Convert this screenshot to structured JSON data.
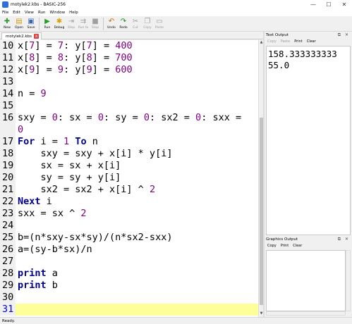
{
  "window": {
    "title": "motylek2.kbs - BASIC-256",
    "minimize": "—",
    "maximize": "☐",
    "close": "✕"
  },
  "menu": [
    "File",
    "Edit",
    "View",
    "Run",
    "Window",
    "Help"
  ],
  "toolbar": [
    {
      "label": "New",
      "icon": "new-icon",
      "glyph": "✚",
      "color": "#2e9e2e",
      "disabled": false
    },
    {
      "label": "Open",
      "icon": "open-icon",
      "glyph": "▤",
      "color": "#d4a017",
      "disabled": false
    },
    {
      "label": "Save",
      "icon": "save-icon",
      "glyph": "▣",
      "color": "#3a66b0",
      "disabled": false
    },
    {
      "label": "Run",
      "icon": "run-icon",
      "glyph": "▶",
      "color": "#1fa21f",
      "disabled": false
    },
    {
      "label": "Debug",
      "icon": "debug-icon",
      "glyph": "✱",
      "color": "#e0a000",
      "disabled": false
    },
    {
      "label": "Step",
      "icon": "step-icon",
      "glyph": "⇥",
      "color": "#a0a0a0",
      "disabled": true
    },
    {
      "label": "Run to",
      "icon": "run-to-icon",
      "glyph": "⇉",
      "color": "#a0a0a0",
      "disabled": true
    },
    {
      "label": "Stop",
      "icon": "stop-icon",
      "glyph": "■",
      "color": "#a0a0a0",
      "disabled": true
    },
    {
      "label": "Undo",
      "icon": "undo-icon",
      "glyph": "↶",
      "color": "#c07000",
      "disabled": false
    },
    {
      "label": "Redo",
      "icon": "redo-icon",
      "glyph": "↷",
      "color": "#1a8a1a",
      "disabled": false
    },
    {
      "label": "Cut",
      "icon": "cut-icon",
      "glyph": "✂",
      "color": "#a0a0a0",
      "disabled": true
    },
    {
      "label": "Copy",
      "icon": "copy-icon",
      "glyph": "❐",
      "color": "#a0a0a0",
      "disabled": true
    },
    {
      "label": "Paste",
      "icon": "paste-icon",
      "glyph": "▭",
      "color": "#a0a0a0",
      "disabled": true
    }
  ],
  "tab": {
    "label": "motylek2.kbs",
    "close": "x"
  },
  "code_lines": [
    {
      "n": "10",
      "tokens": [
        [
          "x[",
          ""
        ],
        [
          "7",
          "num"
        ],
        [
          "] = ",
          ""
        ],
        [
          "7",
          "num"
        ],
        [
          ": y[",
          ""
        ],
        [
          "7",
          "num"
        ],
        [
          "] = ",
          ""
        ],
        [
          "400",
          "num"
        ]
      ]
    },
    {
      "n": "11",
      "tokens": [
        [
          "x[",
          ""
        ],
        [
          "8",
          "num"
        ],
        [
          "] = ",
          ""
        ],
        [
          "8",
          "num"
        ],
        [
          ": y[",
          ""
        ],
        [
          "8",
          "num"
        ],
        [
          "] = ",
          ""
        ],
        [
          "700",
          "num"
        ]
      ]
    },
    {
      "n": "12",
      "tokens": [
        [
          "x[",
          ""
        ],
        [
          "9",
          "num"
        ],
        [
          "] = ",
          ""
        ],
        [
          "9",
          "num"
        ],
        [
          ": y[",
          ""
        ],
        [
          "9",
          "num"
        ],
        [
          "] = ",
          ""
        ],
        [
          "600",
          "num"
        ]
      ]
    },
    {
      "n": "13",
      "tokens": []
    },
    {
      "n": "14",
      "tokens": [
        [
          "n = ",
          ""
        ],
        [
          "9",
          "num"
        ]
      ]
    },
    {
      "n": "15",
      "tokens": []
    },
    {
      "n": "16",
      "tokens": [
        [
          "sxy = ",
          ""
        ],
        [
          "0",
          "num"
        ],
        [
          ": sx = ",
          ""
        ],
        [
          "0",
          "num"
        ],
        [
          ": sy = ",
          ""
        ],
        [
          "0",
          "num"
        ],
        [
          ": sx2 = ",
          ""
        ],
        [
          "0",
          "num"
        ],
        [
          ": sxx =",
          ""
        ]
      ]
    },
    {
      "n": "",
      "tokens": [
        [
          "0",
          "num"
        ]
      ]
    },
    {
      "n": "17",
      "tokens": [
        [
          "For",
          "kw"
        ],
        [
          " i = ",
          ""
        ],
        [
          "1",
          "num"
        ],
        [
          " ",
          ""
        ],
        [
          "To",
          "kw"
        ],
        [
          " n",
          ""
        ]
      ]
    },
    {
      "n": "18",
      "tokens": [
        [
          "    sxy = sxy + x[i] * y[i]",
          ""
        ]
      ]
    },
    {
      "n": "19",
      "tokens": [
        [
          "    sx = sx + x[i]",
          ""
        ]
      ]
    },
    {
      "n": "20",
      "tokens": [
        [
          "    sy = sy + y[i]",
          ""
        ]
      ]
    },
    {
      "n": "21",
      "tokens": [
        [
          "    sx2 = sx2 + x[i] ^ ",
          ""
        ],
        [
          "2",
          "num"
        ]
      ]
    },
    {
      "n": "22",
      "tokens": [
        [
          "Next",
          "kw"
        ],
        [
          " i",
          ""
        ]
      ]
    },
    {
      "n": "23",
      "tokens": [
        [
          "sxx = sx ^ ",
          ""
        ],
        [
          "2",
          "num"
        ]
      ]
    },
    {
      "n": "24",
      "tokens": []
    },
    {
      "n": "25",
      "tokens": [
        [
          "b=(n*sxy-sx*sy)/(n*sx2-sxx)",
          ""
        ]
      ]
    },
    {
      "n": "26",
      "tokens": [
        [
          "a=(sy-b*sx)/n",
          ""
        ]
      ]
    },
    {
      "n": "27",
      "tokens": []
    },
    {
      "n": "28",
      "tokens": [
        [
          "print",
          "kw"
        ],
        [
          " a",
          ""
        ]
      ]
    },
    {
      "n": "29",
      "tokens": [
        [
          "print",
          "kw"
        ],
        [
          " b",
          ""
        ]
      ]
    },
    {
      "n": "30",
      "tokens": []
    },
    {
      "n": "31",
      "tokens": [],
      "current": true
    }
  ],
  "text_output": {
    "title": "Text Output",
    "buttons": [
      {
        "label": "Copy",
        "disabled": true
      },
      {
        "label": "Paste",
        "disabled": true
      },
      {
        "label": "Print",
        "disabled": false
      },
      {
        "label": "Clear",
        "disabled": false
      }
    ],
    "lines": [
      "158.333333333",
      "55.0"
    ],
    "header_icons": "⧉ ✕"
  },
  "graphics_output": {
    "title": "Graphics Output",
    "buttons": [
      {
        "label": "Copy",
        "disabled": false
      },
      {
        "label": "Print",
        "disabled": false
      },
      {
        "label": "Clear",
        "disabled": false
      }
    ],
    "header_icons": "⧉ ✕"
  },
  "status": "Ready."
}
